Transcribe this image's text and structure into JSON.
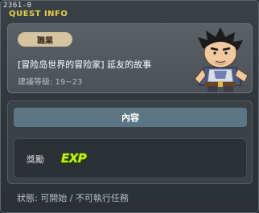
{
  "window": {
    "quest_id": "2361-0",
    "title": "QUEST INFO"
  },
  "quest": {
    "job_badge": "職業",
    "name": "[冒险岛世界的冒险家] 延友的故事",
    "level": "建議等級: 19~23"
  },
  "content": {
    "header": "內容",
    "reward_label": "獎勵",
    "reward_icon_text": "EXP"
  },
  "status": {
    "text": "狀態: 可開始 / 不可執行任務"
  },
  "icons": {
    "npc": "npc-portrait-icon",
    "exp": "exp-icon"
  },
  "colors": {
    "title": "#e9d04a",
    "badge": "#d4c4a0",
    "header_bar": "#5c7685",
    "exp": "#c8f020"
  }
}
